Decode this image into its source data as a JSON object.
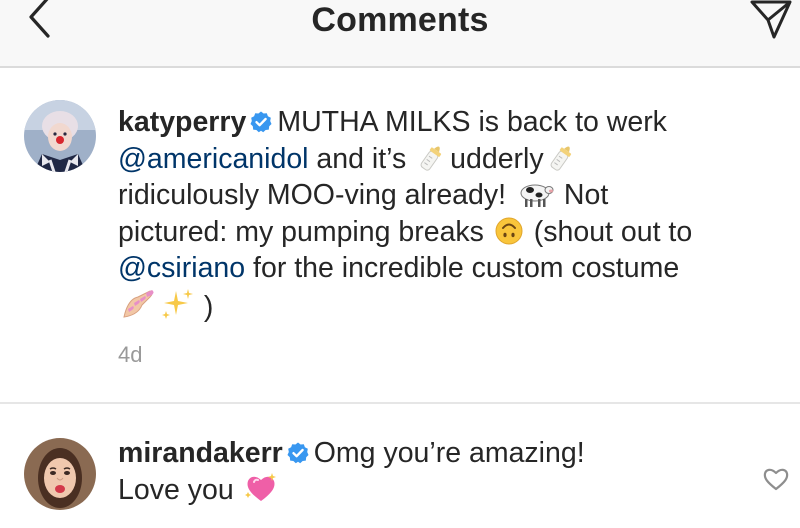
{
  "header": {
    "title": "Comments",
    "back_icon": "chevron-left-icon",
    "share_icon": "paper-plane-icon"
  },
  "colors": {
    "text": "#262626",
    "mention": "#003569",
    "timestamp": "#999999",
    "verified_badge": "#3897f0",
    "header_bg": "#f8f8f8",
    "divider": "#e6e6e6"
  },
  "comments": [
    {
      "username": "katyperry",
      "verified": true,
      "lines": [
        {
          "text1": "MUTHA MILKS is back to werk"
        },
        {
          "mention": "@americanidol",
          "text1": " and it’s ",
          "emoji1": "baby-bottle",
          "text2": "udderly",
          "emoji2": "baby-bottle"
        },
        {
          "text1": "ridiculously MOO-ving already! ",
          "emoji1": "cow",
          "text2": " Not"
        },
        {
          "text1": "pictured: my pumping breaks ",
          "emoji1": "upside-down-face",
          "text2": " (shout out to"
        },
        {
          "mention": "@csiriano",
          "text1": " for the incredible custom costume"
        },
        {
          "emoji1": "nail-polish",
          "emoji2": "sparkles",
          "text1": " )"
        }
      ],
      "timestamp": "4d"
    },
    {
      "username": "mirandakerr",
      "verified": true,
      "lines": [
        {
          "text1": "Omg you’re amazing!"
        },
        {
          "text1": "Love you ",
          "emoji1": "sparkling-heart"
        }
      ],
      "like_icon": "heart-outline-icon"
    }
  ]
}
